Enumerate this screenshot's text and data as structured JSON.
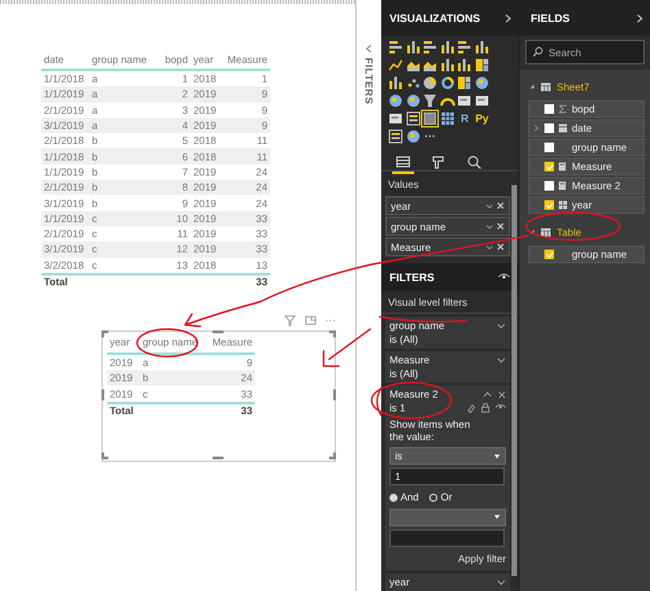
{
  "report": {
    "main_table": {
      "columns": [
        {
          "label": "date",
          "kind": "text"
        },
        {
          "label": "group name",
          "kind": "text"
        },
        {
          "label": "bopd",
          "kind": "number"
        },
        {
          "label": "year",
          "kind": "text"
        },
        {
          "label": "Measure",
          "kind": "number"
        }
      ],
      "rows": [
        [
          "1/1/2018",
          "a",
          "1",
          "2018",
          "1"
        ],
        [
          "1/1/2019",
          "a",
          "2",
          "2019",
          "9"
        ],
        [
          "2/1/2019",
          "a",
          "3",
          "2019",
          "9"
        ],
        [
          "3/1/2019",
          "a",
          "4",
          "2019",
          "9"
        ],
        [
          "2/1/2018",
          "b",
          "5",
          "2018",
          "11"
        ],
        [
          "1/1/2018",
          "b",
          "6",
          "2018",
          "11"
        ],
        [
          "1/1/2019",
          "b",
          "7",
          "2019",
          "24"
        ],
        [
          "2/1/2019",
          "b",
          "8",
          "2019",
          "24"
        ],
        [
          "3/1/2019",
          "b",
          "9",
          "2019",
          "24"
        ],
        [
          "1/1/2019",
          "c",
          "10",
          "2019",
          "33"
        ],
        [
          "2/1/2019",
          "c",
          "11",
          "2019",
          "33"
        ],
        [
          "3/1/2019",
          "c",
          "12",
          "2019",
          "33"
        ],
        [
          "3/2/2018",
          "c",
          "13",
          "2018",
          "13"
        ]
      ],
      "total": {
        "label": "Total",
        "value": "33"
      }
    },
    "visual_header": {
      "more": "···"
    },
    "visual_table": {
      "columns": [
        {
          "label": "year",
          "kind": "text"
        },
        {
          "label": "group name",
          "kind": "text"
        },
        {
          "label": "Measure",
          "kind": "number"
        }
      ],
      "rows": [
        [
          "2019",
          "a",
          "9"
        ],
        [
          "2019",
          "b",
          "24"
        ],
        [
          "2019",
          "c",
          "33"
        ]
      ],
      "total": {
        "label": "Total",
        "value": "33"
      }
    }
  },
  "filters_strip": {
    "label": "FILTERS"
  },
  "visualizations": {
    "title": "VISUALIZATIONS",
    "types": [
      {
        "kind": "bar",
        "selected": false
      },
      {
        "kind": "column",
        "selected": false
      },
      {
        "kind": "bar",
        "selected": false
      },
      {
        "kind": "column",
        "selected": false
      },
      {
        "kind": "bar",
        "selected": false
      },
      {
        "kind": "column",
        "selected": false
      },
      {
        "kind": "line",
        "selected": false
      },
      {
        "kind": "area",
        "selected": false
      },
      {
        "kind": "area",
        "selected": false
      },
      {
        "kind": "column",
        "selected": false
      },
      {
        "kind": "column",
        "selected": false
      },
      {
        "kind": "treemap",
        "selected": false
      },
      {
        "kind": "column",
        "selected": false
      },
      {
        "kind": "scatter",
        "selected": false
      },
      {
        "kind": "pie",
        "selected": false
      },
      {
        "kind": "donut",
        "selected": false
      },
      {
        "kind": "treemap",
        "selected": false
      },
      {
        "kind": "map",
        "selected": false
      },
      {
        "kind": "map",
        "selected": false
      },
      {
        "kind": "map",
        "selected": false
      },
      {
        "kind": "funnel",
        "selected": false
      },
      {
        "kind": "gauge",
        "selected": false
      },
      {
        "kind": "card",
        "selected": false
      },
      {
        "kind": "card",
        "selected": false
      },
      {
        "kind": "card",
        "selected": false
      },
      {
        "kind": "slicer",
        "selected": false
      },
      {
        "kind": "table",
        "selected": true
      },
      {
        "kind": "matrix",
        "selected": false
      },
      {
        "kind": "script",
        "glyph": "R",
        "selected": false
      },
      {
        "kind": "script",
        "glyph": "Py",
        "selected": false
      },
      {
        "kind": "slicer",
        "selected": false
      },
      {
        "kind": "map",
        "selected": false
      },
      {
        "kind": "more",
        "glyph": "···",
        "selected": false
      }
    ],
    "tabs": [
      {
        "kind": "fields",
        "selected": true
      },
      {
        "kind": "format",
        "selected": false
      },
      {
        "kind": "analytics",
        "selected": false
      }
    ],
    "values_label": "Values",
    "wells": [
      {
        "label": "year"
      },
      {
        "label": "group name"
      },
      {
        "label": "Measure"
      }
    ]
  },
  "filters": {
    "title": "FILTERS",
    "section": "Visual level filters",
    "cards": [
      {
        "field": "group name",
        "summary": "is (All)",
        "expanded": false
      },
      {
        "field": "Measure",
        "summary": "is (All)",
        "expanded": false
      },
      {
        "field": "Measure 2",
        "summary": "is 1",
        "expanded": true,
        "prompt": "Show items when the value:",
        "operator": "is",
        "value": "1",
        "logic": [
          {
            "label": "And",
            "selected": true
          },
          {
            "label": "Or",
            "selected": false
          }
        ],
        "apply": "Apply filter"
      },
      {
        "field": "year",
        "expanded": false
      }
    ]
  },
  "fields": {
    "title": "FIELDS",
    "search": {
      "placeholder": "Search"
    },
    "tables": [
      {
        "name": "Sheet7",
        "expanded": true,
        "fields": [
          {
            "name": "bopd",
            "kind": "sum",
            "checked": false
          },
          {
            "name": "date",
            "kind": "date",
            "checked": false
          },
          {
            "name": "group name",
            "kind": "text",
            "checked": false
          },
          {
            "name": "Measure",
            "kind": "measure",
            "checked": true
          },
          {
            "name": "Measure 2",
            "kind": "measure",
            "checked": false
          },
          {
            "name": "year",
            "kind": "hierarchy",
            "checked": true
          }
        ]
      },
      {
        "name": "Table",
        "expanded": true,
        "fields": [
          {
            "name": "group name",
            "kind": "text",
            "checked": true
          }
        ]
      }
    ]
  }
}
